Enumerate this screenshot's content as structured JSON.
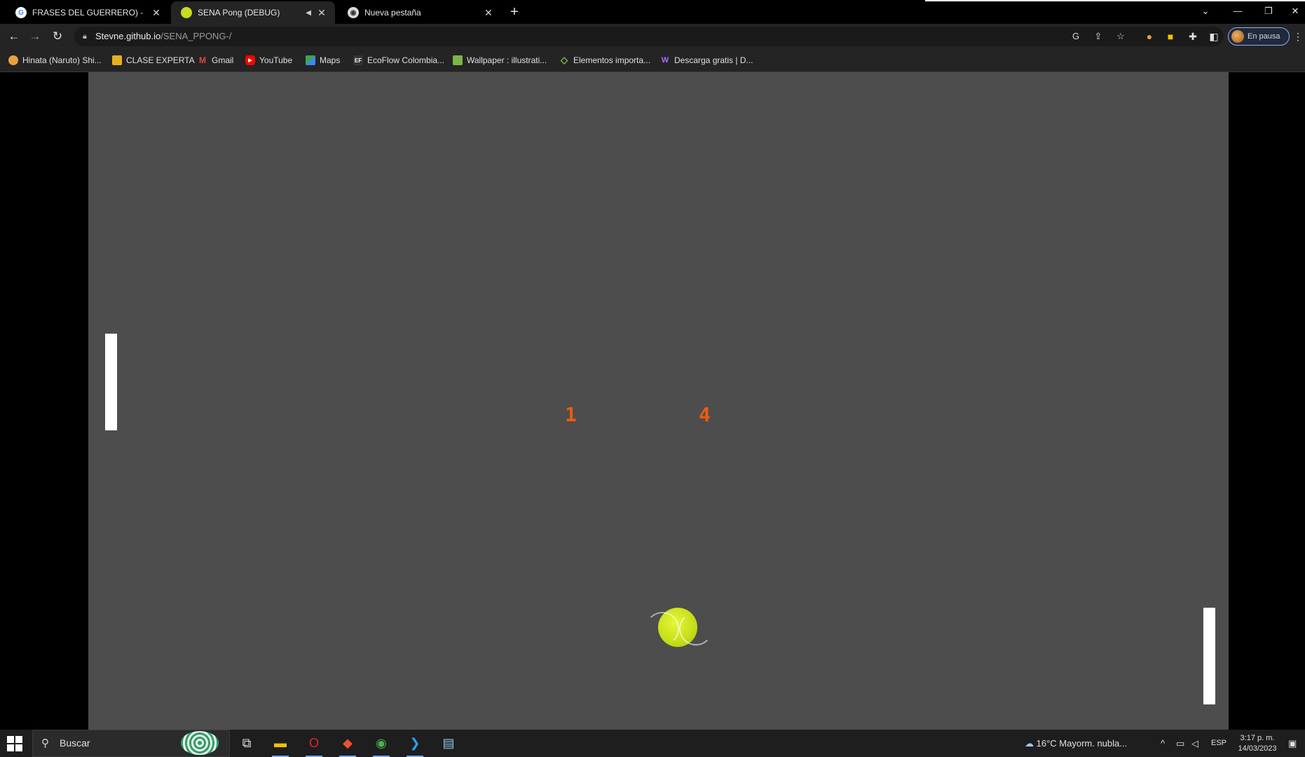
{
  "browser": {
    "tabs": [
      {
        "title": "FRASES DEL GUERRERO) - Búsqu",
        "icon": "google-icon",
        "active": false
      },
      {
        "title": "SENA Pong (DEBUG)",
        "icon": "tennis-ball-icon",
        "active": true
      },
      {
        "title": "Nueva pestaña",
        "icon": "chrome-icon",
        "active": false
      }
    ],
    "new_tab_label": "+",
    "window_controls": {
      "minimize": "—",
      "restore": "❐",
      "close": "✕",
      "tab_search": "⌄"
    }
  },
  "toolbar": {
    "url_host": "Stevne.github.io",
    "url_path": "/SENA_PPONG-/",
    "profile_label": "En pausa"
  },
  "bookmarks": [
    {
      "label": "Hinata (Naruto) Shi...",
      "icon": "avatar-bookmark-icon",
      "color": "#e8a040"
    },
    {
      "label": "CLASE EXPERTA",
      "icon": "folder-icon",
      "color": "#e8b020"
    },
    {
      "label": "Gmail",
      "icon": "gmail-icon",
      "color": "#ea4335"
    },
    {
      "label": "YouTube",
      "icon": "youtube-icon",
      "color": "#ff0000"
    },
    {
      "label": "Maps",
      "icon": "maps-icon",
      "color": "#34a853"
    },
    {
      "label": "EcoFlow Colombia...",
      "icon": "ecoflow-icon",
      "color": "#333333"
    },
    {
      "label": "Wallpaper : illustrati...",
      "icon": "wallpaper-icon",
      "color": "#7ab648"
    },
    {
      "label": "Elementos importa...",
      "icon": "diamond-icon",
      "color": "#7ac943"
    },
    {
      "label": "Descarga gratis | D...",
      "icon": "w-logo-icon",
      "color": "#8a4fff"
    }
  ],
  "game": {
    "score_left": "1",
    "score_right": "4",
    "background_color": "#4d4d4d",
    "paddle_color": "#ffffff",
    "score_color": "#f05a10",
    "ball_color": "#d4e82a"
  },
  "taskbar": {
    "search_placeholder": "Buscar",
    "apps": [
      "task-view-icon",
      "file-explorer-icon",
      "opera-icon",
      "git-icon",
      "chrome-icon",
      "vscode-icon",
      "notepad-icon"
    ],
    "weather": "16°C  Mayorm. nubla...",
    "language": "ESP",
    "time": "3:17 p. m.",
    "date": "14/03/2023"
  }
}
